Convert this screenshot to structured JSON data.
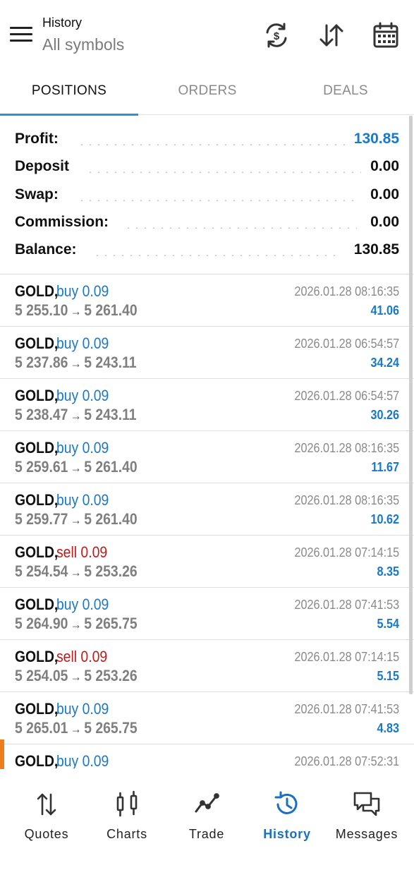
{
  "header": {
    "title": "History",
    "subtitle": "All symbols"
  },
  "tabs": [
    {
      "label": "POSITIONS",
      "active": true
    },
    {
      "label": "ORDERS",
      "active": false
    },
    {
      "label": "DEALS",
      "active": false
    }
  ],
  "summary": {
    "profit_label": "Profit:",
    "profit_value": "130.85",
    "deposit_label": "Deposit",
    "deposit_value": "0.00",
    "swap_label": "Swap:",
    "swap_value": "0.00",
    "commission_label": "Commission:",
    "commission_value": "0.00",
    "balance_label": "Balance:",
    "balance_value": "130.85"
  },
  "deals": [
    {
      "symbol": "GOLD,",
      "side": "buy 0.09",
      "type": "buy",
      "open": "5 255.10",
      "close": "5 261.40",
      "time": "2026.01.28 08:16:35",
      "profit": "41.06"
    },
    {
      "symbol": "GOLD,",
      "side": "buy 0.09",
      "type": "buy",
      "open": "5 237.86",
      "close": "5 243.11",
      "time": "2026.01.28 06:54:57",
      "profit": "34.24"
    },
    {
      "symbol": "GOLD,",
      "side": "buy 0.09",
      "type": "buy",
      "open": "5 238.47",
      "close": "5 243.11",
      "time": "2026.01.28 06:54:57",
      "profit": "30.26"
    },
    {
      "symbol": "GOLD,",
      "side": "buy 0.09",
      "type": "buy",
      "open": "5 259.61",
      "close": "5 261.40",
      "time": "2026.01.28 08:16:35",
      "profit": "11.67"
    },
    {
      "symbol": "GOLD,",
      "side": "buy 0.09",
      "type": "buy",
      "open": "5 259.77",
      "close": "5 261.40",
      "time": "2026.01.28 08:16:35",
      "profit": "10.62"
    },
    {
      "symbol": "GOLD,",
      "side": "sell 0.09",
      "type": "sell",
      "open": "5 254.54",
      "close": "5 253.26",
      "time": "2026.01.28 07:14:15",
      "profit": "8.35"
    },
    {
      "symbol": "GOLD,",
      "side": "buy 0.09",
      "type": "buy",
      "open": "5 264.90",
      "close": "5 265.75",
      "time": "2026.01.28 07:41:53",
      "profit": "5.54"
    },
    {
      "symbol": "GOLD,",
      "side": "sell 0.09",
      "type": "sell",
      "open": "5 254.05",
      "close": "5 253.26",
      "time": "2026.01.28 07:14:15",
      "profit": "5.15"
    },
    {
      "symbol": "GOLD,",
      "side": "buy 0.09",
      "type": "buy",
      "open": "5 265.01",
      "close": "5 265.75",
      "time": "2026.01.28 07:41:53",
      "profit": "4.83"
    },
    {
      "symbol": "GOLD,",
      "side": "buy 0.09",
      "type": "buy",
      "open": "",
      "close": "",
      "time": "2026.01.28 07:52:31",
      "profit": ""
    }
  ],
  "nav": {
    "quotes": "Quotes",
    "charts": "Charts",
    "trade": "Trade",
    "history": "History",
    "messages": "Messages"
  },
  "colors": {
    "accent": "#1a78c8",
    "sell": "#c21818",
    "tab_indicator": "#2d8fd7",
    "marker": "#ee7d1c"
  },
  "icons": [
    "menu-icon",
    "sync-icon",
    "sort-icon",
    "calendar-icon",
    "quotes-icon",
    "charts-icon",
    "trade-icon",
    "history-icon",
    "messages-icon"
  ]
}
